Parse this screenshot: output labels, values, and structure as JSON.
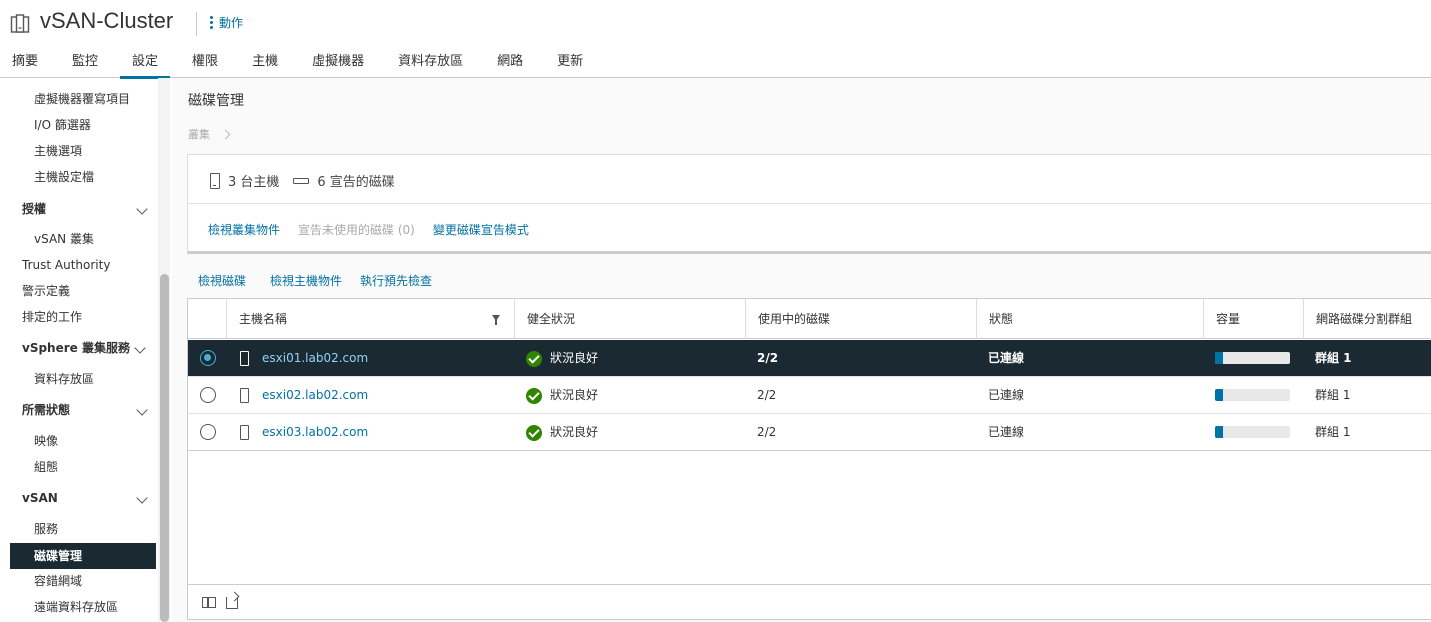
{
  "header": {
    "title": "vSAN-Cluster",
    "actions_label": "動作"
  },
  "tabs": [
    {
      "label": "摘要"
    },
    {
      "label": "監控"
    },
    {
      "label": "設定"
    },
    {
      "label": "權限"
    },
    {
      "label": "主機"
    },
    {
      "label": "虛擬機器"
    },
    {
      "label": "資料存放區"
    },
    {
      "label": "網路"
    },
    {
      "label": "更新"
    }
  ],
  "active_tab": "設定",
  "sidebar": {
    "items": [
      {
        "label": "虛擬機器覆寫項目"
      },
      {
        "label": "I/O 篩選器"
      },
      {
        "label": "主機選項"
      },
      {
        "label": "主機設定檔"
      },
      {
        "label": "授權"
      },
      {
        "label": "vSAN 叢集"
      },
      {
        "label": "Trust Authority"
      },
      {
        "label": "警示定義"
      },
      {
        "label": "排定的工作"
      },
      {
        "label": "vSphere 叢集服務"
      },
      {
        "label": "資料存放區"
      },
      {
        "label": "所需狀態"
      },
      {
        "label": "映像"
      },
      {
        "label": "組態"
      },
      {
        "label": "vSAN"
      },
      {
        "label": "服務"
      },
      {
        "label": "磁碟管理"
      },
      {
        "label": "容錯網域"
      },
      {
        "label": "遠端資料存放區"
      }
    ]
  },
  "main": {
    "title": "磁碟管理",
    "breadcrumb": "叢集",
    "summary": {
      "hosts": "3 台主機",
      "disks": "6 宣告的磁碟"
    },
    "card_links": {
      "view_objects": "檢視叢集物件",
      "claim_unused": "宣告未使用的磁碟 (0)",
      "change_mode": "變更磁碟宣告模式"
    },
    "grid_links": {
      "view_disks": "檢視磁碟",
      "view_host_objects": "檢視主機物件",
      "run_precheck": "執行預先檢查"
    },
    "table": {
      "columns": [
        "主機名稱",
        "健全狀況",
        "使用中的磁碟",
        "狀態",
        "容量",
        "網路磁碟分割群組"
      ],
      "rows": [
        {
          "host": "esxi01.lab02.com",
          "health": "狀況良好",
          "disks": "2/2",
          "state": "已連線",
          "capacity": 0.1,
          "group": "群組 1",
          "selected": true
        },
        {
          "host": "esxi02.lab02.com",
          "health": "狀況良好",
          "disks": "2/2",
          "state": "已連線",
          "capacity": 0.1,
          "group": "群組 1",
          "selected": false
        },
        {
          "host": "esxi03.lab02.com",
          "health": "狀況良好",
          "disks": "2/2",
          "state": "已連線",
          "capacity": 0.1,
          "group": "群組 1",
          "selected": false
        }
      ]
    }
  },
  "colors": {
    "accent": "#0072a3",
    "selected_bg": "#1b2a32",
    "ok_green": "#2f8400"
  }
}
